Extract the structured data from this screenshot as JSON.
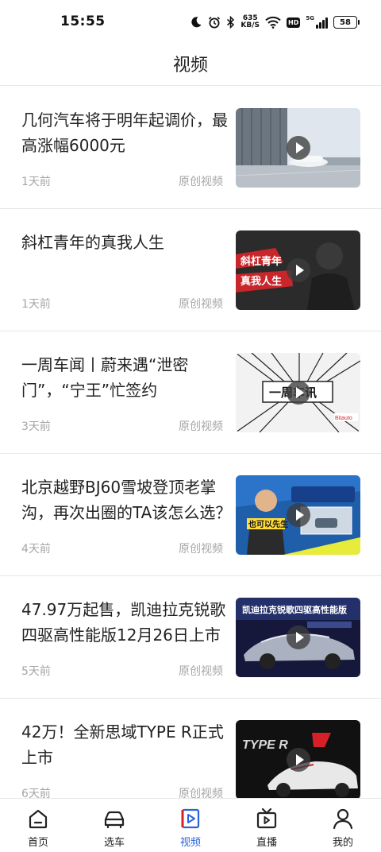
{
  "status_bar": {
    "time": "15:55",
    "net_speed_value": "635",
    "net_speed_unit": "KB/S",
    "hd_badge": "HD",
    "network_type": "5G",
    "battery": "58",
    "icons": [
      "moon-icon",
      "alarm-icon",
      "bluetooth-icon",
      "wifi-icon",
      "signal-icon",
      "battery-icon"
    ]
  },
  "header": {
    "title": "视频"
  },
  "videos": [
    {
      "title": "几何汽车将于明年起调价，最高涨幅6000元",
      "time": "1天前",
      "source": "原创视频"
    },
    {
      "title": "斜杠青年的真我人生",
      "time": "1天前",
      "source": "原创视频",
      "thumb_text": "斜杠青年 真我人生"
    },
    {
      "title": "一周车闻丨蔚来遇“泄密门”，“宁王”忙签约",
      "time": "3天前",
      "source": "原创视频",
      "thumb_text": "一周车讯"
    },
    {
      "title": "北京越野BJ60雪坡登顶老掌沟，再次出圈的TA该怎么选？",
      "time": "4天前",
      "source": "原创视频",
      "thumb_text": "也可以先生"
    },
    {
      "title": "47.97万起售，凯迪拉克锐歌四驱高性能版12月26日上市",
      "time": "5天前",
      "source": "原创视频",
      "thumb_text": "凯迪拉克锐歌四驱高性能版"
    },
    {
      "title": "42万！全新思域TYPE R正式上市",
      "time": "6天前",
      "source": "原创视频",
      "thumb_text": "TYPE R"
    }
  ],
  "tab_bar": {
    "tabs": [
      {
        "label": "首页",
        "icon": "home-icon"
      },
      {
        "label": "选车",
        "icon": "car-icon"
      },
      {
        "label": "视频",
        "icon": "video-icon",
        "active": true
      },
      {
        "label": "直播",
        "icon": "tv-icon"
      },
      {
        "label": "我的",
        "icon": "person-icon"
      }
    ],
    "active_color": "#2a63d8"
  }
}
